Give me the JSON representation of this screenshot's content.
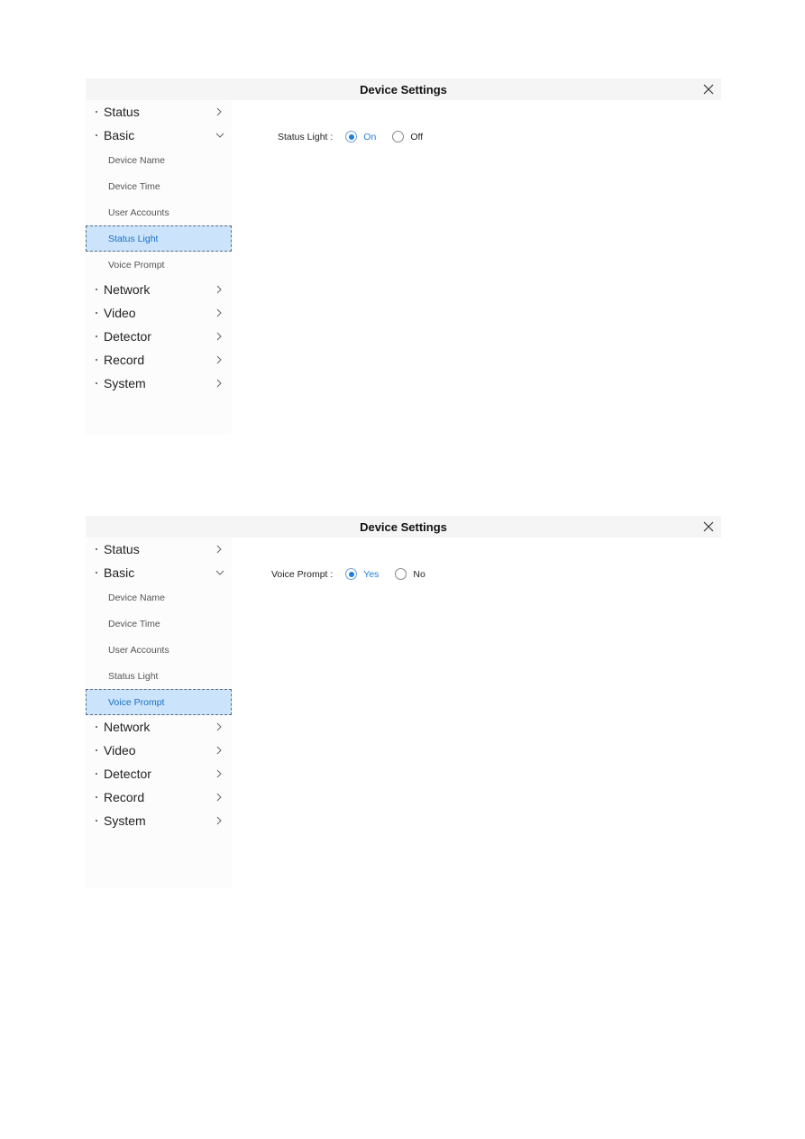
{
  "panels": [
    {
      "title": "Device Settings",
      "close_icon": "close-icon",
      "sidebar": {
        "sections": [
          {
            "label": "Status",
            "chevron": "chevron-right-icon"
          },
          {
            "label": "Basic",
            "chevron": "chevron-down-icon",
            "expanded": true,
            "items": [
              {
                "label": "Device Name"
              },
              {
                "label": "Device Time"
              },
              {
                "label": "User Accounts"
              },
              {
                "label": "Status Light",
                "active": true
              },
              {
                "label": "Voice Prompt"
              }
            ]
          },
          {
            "label": "Network",
            "chevron": "chevron-right-icon"
          },
          {
            "label": "Video",
            "chevron": "chevron-right-icon"
          },
          {
            "label": "Detector",
            "chevron": "chevron-right-icon"
          },
          {
            "label": "Record",
            "chevron": "chevron-right-icon"
          },
          {
            "label": "System",
            "chevron": "chevron-right-icon"
          }
        ]
      },
      "content": {
        "field_label": "Status Light :",
        "options": [
          {
            "label": "On",
            "checked": true
          },
          {
            "label": "Off",
            "checked": false
          }
        ]
      }
    },
    {
      "title": "Device Settings",
      "close_icon": "close-icon",
      "sidebar": {
        "sections": [
          {
            "label": "Status",
            "chevron": "chevron-right-icon"
          },
          {
            "label": "Basic",
            "chevron": "chevron-down-icon",
            "expanded": true,
            "items": [
              {
                "label": "Device Name"
              },
              {
                "label": "Device Time"
              },
              {
                "label": "User Accounts"
              },
              {
                "label": "Status Light"
              },
              {
                "label": "Voice Prompt",
                "active": true
              }
            ]
          },
          {
            "label": "Network",
            "chevron": "chevron-right-icon"
          },
          {
            "label": "Video",
            "chevron": "chevron-right-icon"
          },
          {
            "label": "Detector",
            "chevron": "chevron-right-icon"
          },
          {
            "label": "Record",
            "chevron": "chevron-right-icon"
          },
          {
            "label": "System",
            "chevron": "chevron-right-icon"
          }
        ]
      },
      "content": {
        "field_label": "Voice Prompt :",
        "options": [
          {
            "label": "Yes",
            "checked": true
          },
          {
            "label": "No",
            "checked": false
          }
        ]
      }
    }
  ],
  "colors": {
    "accent": "#1e7fd8",
    "active_bg": "#cce4fb",
    "titlebar_bg": "#f5f5f5",
    "sidebar_bg": "#fcfcfc"
  }
}
